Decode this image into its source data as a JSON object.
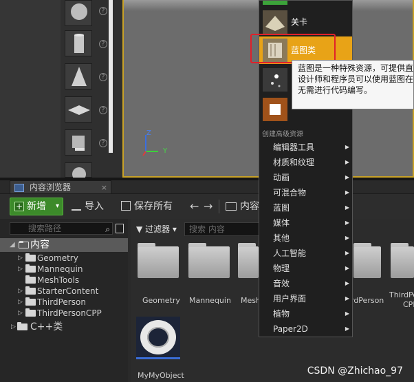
{
  "menu": {
    "level_label": "关卡",
    "blueprint_label": "蓝图类",
    "advanced_section": "创建高级资源",
    "items": [
      "编辑器工具",
      "材质和纹理",
      "动画",
      "可混合物",
      "蓝图",
      "媒体",
      "其他",
      "人工智能",
      "物理",
      "音效",
      "用户界面",
      "植物",
      "Paper2D"
    ],
    "submenu_arrow": "▶"
  },
  "tooltip": {
    "lines": [
      "蓝图是一种特殊资源，可提供直",
      "设计师和程序员可以使用蓝图在",
      "无需进行代码编写。"
    ]
  },
  "content_browser": {
    "tab_label": "内容浏览器",
    "tab_close": "×",
    "add_label": "新增",
    "add_caret": "▾",
    "import_label": "导入",
    "save_all_label": "保存所有",
    "back_arrow": "←",
    "forward_arrow": "→",
    "path_label": "内容",
    "search_path_placeholder": "搜索路径",
    "filter_label": "过滤器",
    "filter_caret": "▾",
    "search_content_placeholder": "搜索 内容"
  },
  "tree": {
    "root_label": "内容",
    "folders": [
      "Geometry",
      "Mannequin",
      "MeshTools",
      "StarterContent",
      "ThirdPerson",
      "ThirdPersonCPP"
    ],
    "cpp_label": "C++类"
  },
  "assets": {
    "folders": [
      "Geometry",
      "Mannequin",
      "Mesh",
      "rdPerson",
      "ThirdPer",
      "CPP"
    ],
    "object_label": "MyMyObject"
  },
  "viewport": {
    "axis_z": "Z",
    "axis_y": "Y"
  },
  "watermark": "CSDN @Zhichao_97",
  "colors": {
    "accent_orange": "#e8a317",
    "add_green": "#3c8a2a",
    "highlight_red": "#e0202a"
  }
}
